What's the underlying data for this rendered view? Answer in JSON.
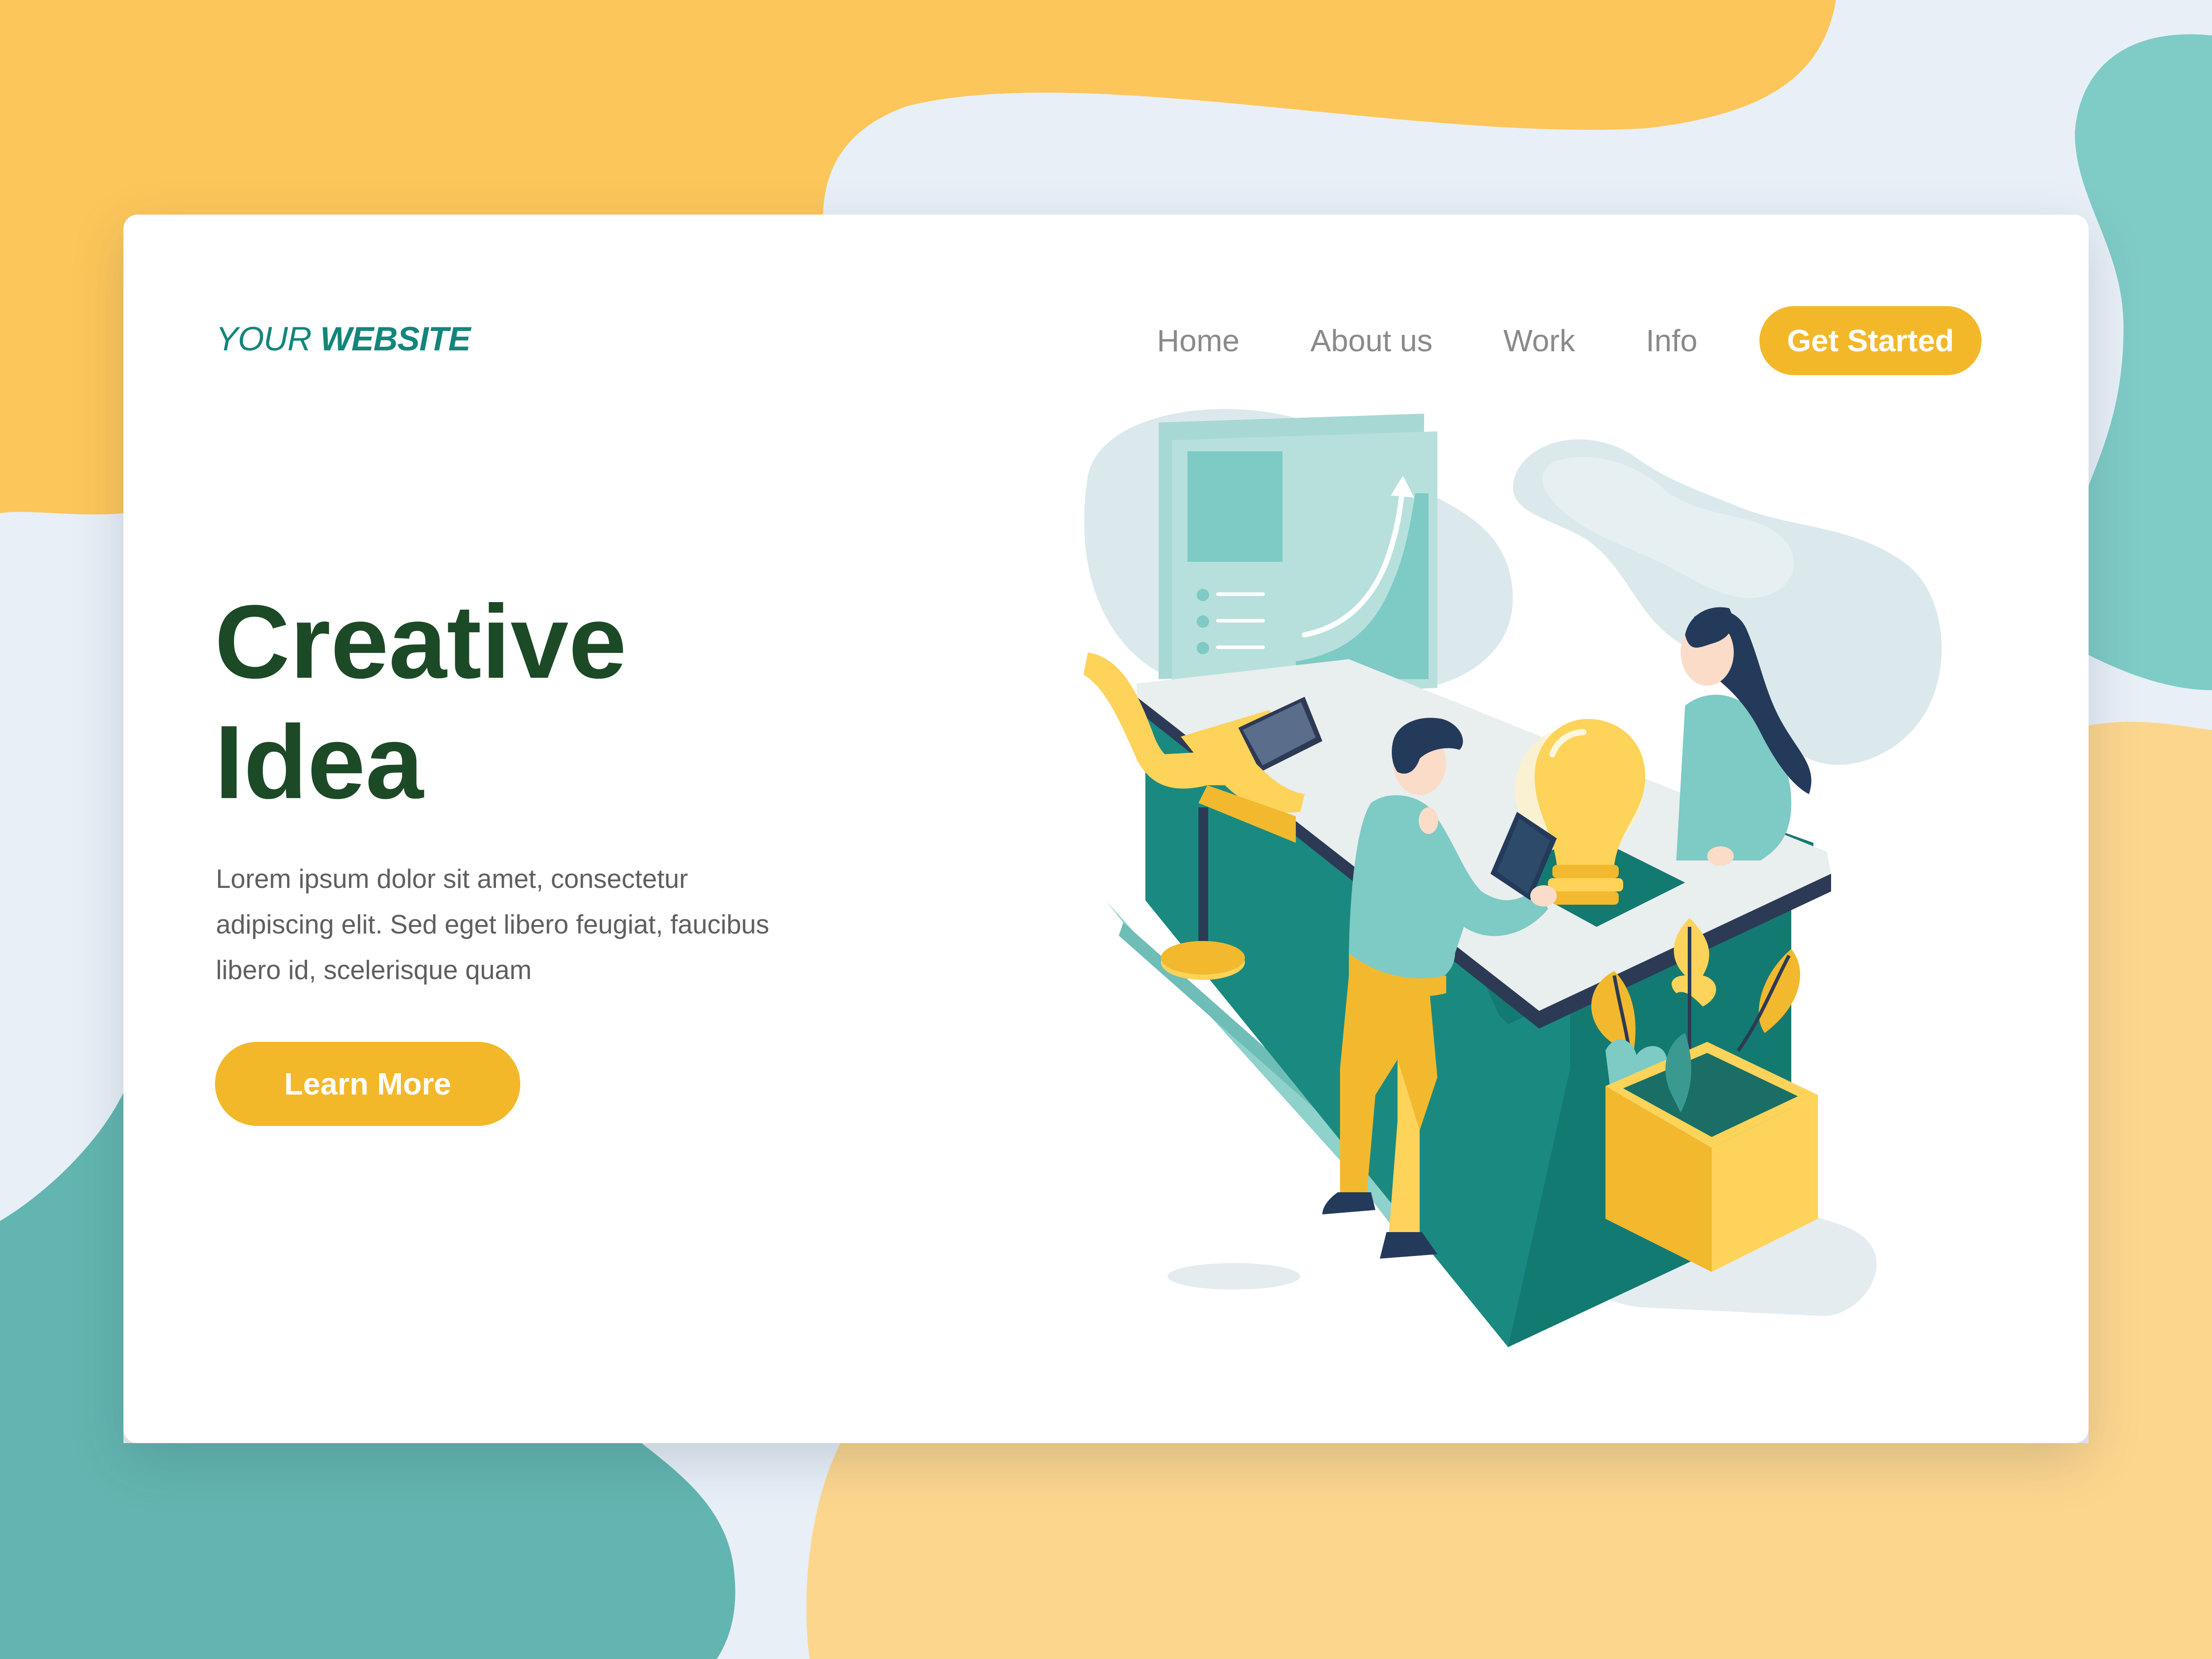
{
  "header": {
    "brand_light": "YOUR",
    "brand_bold": "WEBSITE",
    "nav": [
      "Home",
      "About us",
      "Work",
      "Info"
    ],
    "cta_label": "Get Started"
  },
  "hero": {
    "title_line1": "Creative",
    "title_line2": "Idea",
    "body_lines": [
      "Lorem ipsum dolor sit amet, consectetur",
      "adipiscing elit. Sed eget libero feugiat, faucibus",
      "libero id, scelerisque quam"
    ],
    "button_label": "Learn More"
  },
  "colors": {
    "accent_yellow": "#f3b82a",
    "brand_teal": "#14857b",
    "title_green": "#1c4a26",
    "bg_teal": "#62b5b0",
    "bg_yellow": "#fdc65a",
    "bg_light": "#e8eff7"
  },
  "illustration": {
    "description_icons": [
      "dashboard-screen-icon",
      "laptop-icon",
      "lightbulb-icon",
      "chair-icon",
      "plant-pot-icon",
      "tablet-icon",
      "man-figure-icon",
      "woman-figure-icon"
    ]
  }
}
